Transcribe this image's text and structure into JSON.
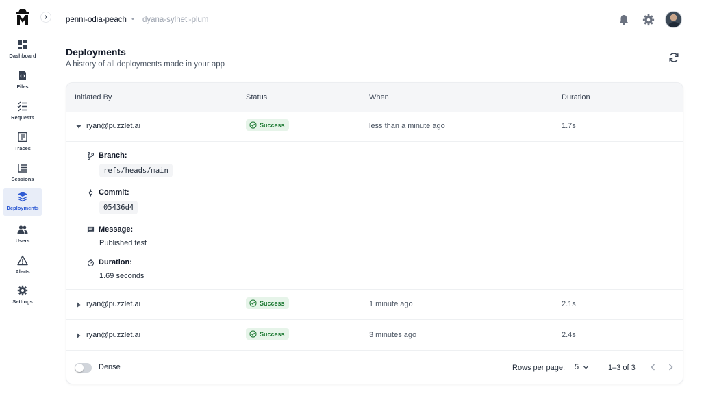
{
  "sidebar": {
    "items": [
      {
        "label": "Dashboard",
        "icon": "dashboard-icon"
      },
      {
        "label": "Files",
        "icon": "file-code-icon"
      },
      {
        "label": "Requests",
        "icon": "checklist-icon"
      },
      {
        "label": "Traces",
        "icon": "document-icon"
      },
      {
        "label": "Sessions",
        "icon": "list-icon"
      },
      {
        "label": "Deployments",
        "icon": "layers-icon",
        "active": true
      },
      {
        "label": "Users",
        "icon": "users-icon"
      },
      {
        "label": "Alerts",
        "icon": "warning-icon"
      },
      {
        "label": "Settings",
        "icon": "gear-icon"
      }
    ]
  },
  "header": {
    "project": "penni-odia-peach",
    "environment": "dyana-sylheti-plum"
  },
  "page": {
    "title": "Deployments",
    "subtitle": "A history of all deployments made in your app"
  },
  "table": {
    "columns": [
      "Initiated By",
      "Status",
      "When",
      "Duration"
    ],
    "rows": [
      {
        "initiated_by": "ryan@puzzlet.ai",
        "status": "Success",
        "when": "less than a minute ago",
        "duration": "1.7s",
        "expanded": true
      },
      {
        "initiated_by": "ryan@puzzlet.ai",
        "status": "Success",
        "when": "1 minute ago",
        "duration": "2.1s",
        "expanded": false
      },
      {
        "initiated_by": "ryan@puzzlet.ai",
        "status": "Success",
        "when": "3 minutes ago",
        "duration": "2.4s",
        "expanded": false
      }
    ],
    "details": {
      "branch_label": "Branch:",
      "branch": "refs/heads/main",
      "commit_label": "Commit:",
      "commit": "05436d4",
      "message_label": "Message:",
      "message": "Published test",
      "duration_label": "Duration:",
      "duration": "1.69 seconds"
    }
  },
  "footer": {
    "dense_label": "Dense",
    "dense_on": false,
    "rows_per_page_label": "Rows per page:",
    "rows_per_page": "5",
    "range": "1–3 of 3"
  },
  "colors": {
    "accent": "#2f5bd3",
    "success_bg": "#e6f4e9",
    "success_text": "#1e7a34"
  }
}
